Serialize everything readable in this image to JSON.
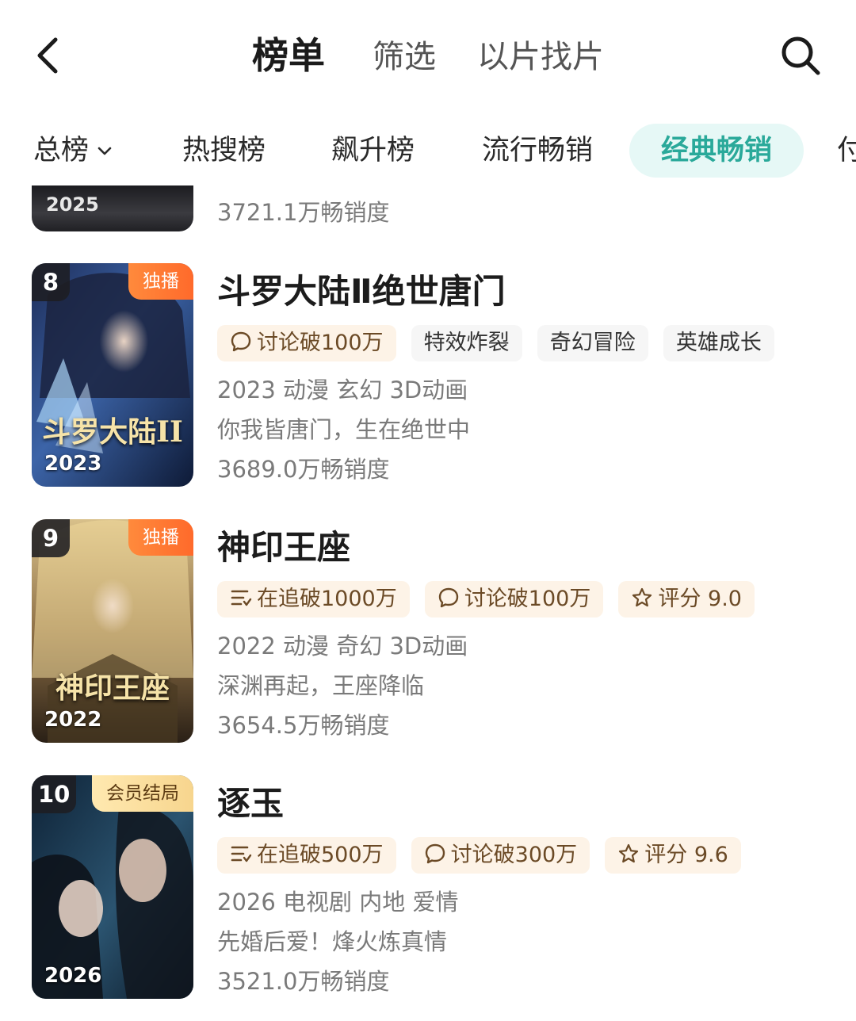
{
  "header": {
    "back_icon": "back-chevron-icon",
    "title": "榜单",
    "tabs": [
      "筛选",
      "以片找片"
    ],
    "search_icon": "search-icon"
  },
  "categories": {
    "items": [
      "总榜",
      "热搜榜",
      "飙升榜",
      "流行畅销",
      "经典畅销",
      "付"
    ],
    "active": "经典畅销",
    "active_color": "#2aa99a"
  },
  "previous_item": {
    "cover_year": "2025",
    "sales": "3721.1万畅销度"
  },
  "items": [
    {
      "rank": "8",
      "badge": "独播",
      "cover_year": "2023",
      "cover_art_text": "斗罗大陆II",
      "title": "斗罗大陆Ⅱ绝世唐门",
      "tags": [
        {
          "icon": "comment-icon",
          "text": "讨论破100万"
        },
        {
          "icon": "",
          "text": "特效炸裂"
        },
        {
          "icon": "",
          "text": "奇幻冒险"
        },
        {
          "icon": "",
          "text": "英雄成长"
        }
      ],
      "info": "2023 动漫 玄幻 3D动画",
      "slogan": "你我皆唐门，生在绝世中",
      "sales": "3689.0万畅销度"
    },
    {
      "rank": "9",
      "badge": "独播",
      "cover_year": "2022",
      "cover_art_text": "神印王座",
      "title": "神印王座",
      "tags": [
        {
          "icon": "list-icon",
          "text": "在追破1000万"
        },
        {
          "icon": "comment-icon",
          "text": "讨论破100万"
        },
        {
          "icon": "star-icon",
          "text": "评分 9.0"
        }
      ],
      "info": "2022 动漫 奇幻 3D动画",
      "slogan": "深渊再起，王座降临",
      "sales": "3654.5万畅销度"
    },
    {
      "rank": "10",
      "badge": "会员结局",
      "cover_year": "2026",
      "cover_art_text": "",
      "title": "逐玉",
      "tags": [
        {
          "icon": "list-icon",
          "text": "在追破500万"
        },
        {
          "icon": "comment-icon",
          "text": "讨论破300万"
        },
        {
          "icon": "star-icon",
          "text": "评分 9.6"
        }
      ],
      "info": "2026 电视剧 内地 爱情",
      "slogan": "先婚后爱！烽火炼真情",
      "sales": "3521.0万畅销度"
    }
  ]
}
